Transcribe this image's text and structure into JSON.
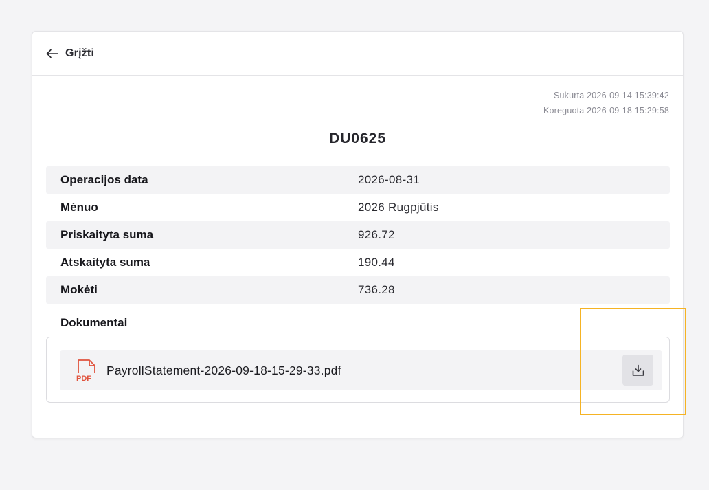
{
  "header": {
    "back_label": "Grįžti"
  },
  "meta": {
    "created": "Sukurta 2026-09-14 15:39:42",
    "modified": "Koreguota 2026-09-18 15:29:58"
  },
  "document": {
    "title": "DU0625"
  },
  "details": [
    {
      "label": "Operacijos data",
      "value": "2026-08-31"
    },
    {
      "label": "Mėnuo",
      "value": "2026 Rugpjūtis"
    },
    {
      "label": "Priskaityta suma",
      "value": "926.72"
    },
    {
      "label": "Atskaityta suma",
      "value": "190.44"
    },
    {
      "label": "Mokėti",
      "value": "736.28"
    }
  ],
  "documents": {
    "heading": "Dokumentai",
    "files": [
      {
        "name": "PayrollStatement-2026-09-18-15-29-33.pdf",
        "type_label": "PDF",
        "icon": "pdf-file-icon"
      }
    ],
    "download_icon": "download-icon"
  },
  "colors": {
    "background": "#f4f4f6",
    "card": "#ffffff",
    "row_shade": "#f3f3f5",
    "pdf_red": "#e0533d",
    "highlight": "#f5b324"
  }
}
